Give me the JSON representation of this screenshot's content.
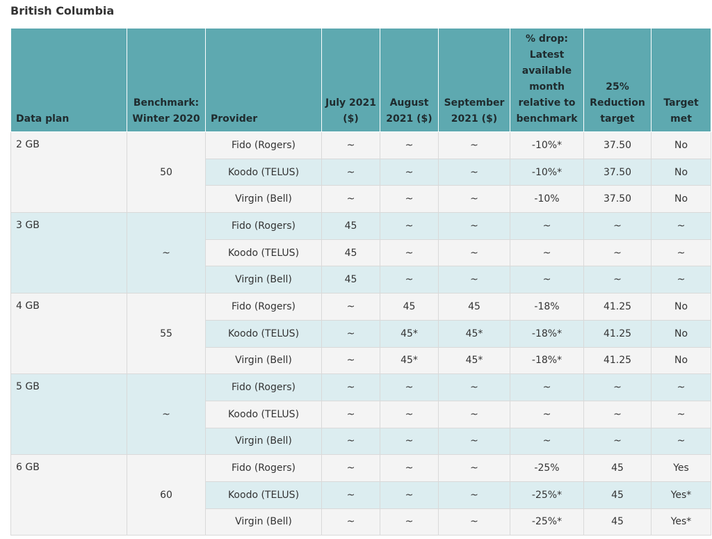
{
  "heading": "British Columbia",
  "columns": [
    "Data plan",
    "Benchmark: Winter 2020",
    "Provider",
    "July 2021 ($)",
    "August 2021 ($)",
    "September 2021 ($)",
    "% drop: Latest available month relative to benchmark",
    "25% Reduction target",
    "Target met"
  ],
  "groups": [
    {
      "plan": "2 GB",
      "benchmark": "50",
      "rows": [
        {
          "provider": "Fido (Rogers)",
          "july": "~",
          "august": "~",
          "september": "~",
          "drop": "-10%*",
          "target": "37.50",
          "met": "No"
        },
        {
          "provider": "Koodo (TELUS)",
          "july": "~",
          "august": "~",
          "september": "~",
          "drop": "-10%*",
          "target": "37.50",
          "met": "No"
        },
        {
          "provider": "Virgin (Bell)",
          "july": "~",
          "august": "~",
          "september": "~",
          "drop": "-10%",
          "target": "37.50",
          "met": "No"
        }
      ]
    },
    {
      "plan": "3 GB",
      "benchmark": "~",
      "rows": [
        {
          "provider": "Fido (Rogers)",
          "july": "45",
          "august": "~",
          "september": "~",
          "drop": "~",
          "target": "~",
          "met": "~"
        },
        {
          "provider": "Koodo (TELUS)",
          "july": "45",
          "august": "~",
          "september": "~",
          "drop": "~",
          "target": "~",
          "met": "~"
        },
        {
          "provider": "Virgin (Bell)",
          "july": "45",
          "august": "~",
          "september": "~",
          "drop": "~",
          "target": "~",
          "met": "~"
        }
      ]
    },
    {
      "plan": "4 GB",
      "benchmark": "55",
      "rows": [
        {
          "provider": "Fido (Rogers)",
          "july": "~",
          "august": "45",
          "september": "45",
          "drop": "-18%",
          "target": "41.25",
          "met": "No"
        },
        {
          "provider": "Koodo (TELUS)",
          "july": "~",
          "august": "45*",
          "september": "45*",
          "drop": "-18%*",
          "target": "41.25",
          "met": "No"
        },
        {
          "provider": "Virgin (Bell)",
          "july": "~",
          "august": "45*",
          "september": "45*",
          "drop": "-18%*",
          "target": "41.25",
          "met": "No"
        }
      ]
    },
    {
      "plan": "5 GB",
      "benchmark": "~",
      "rows": [
        {
          "provider": "Fido (Rogers)",
          "july": "~",
          "august": "~",
          "september": "~",
          "drop": "~",
          "target": "~",
          "met": "~"
        },
        {
          "provider": "Koodo (TELUS)",
          "july": "~",
          "august": "~",
          "september": "~",
          "drop": "~",
          "target": "~",
          "met": "~"
        },
        {
          "provider": "Virgin (Bell)",
          "july": "~",
          "august": "~",
          "september": "~",
          "drop": "~",
          "target": "~",
          "met": "~"
        }
      ]
    },
    {
      "plan": "6 GB",
      "benchmark": "60",
      "rows": [
        {
          "provider": "Fido (Rogers)",
          "july": "~",
          "august": "~",
          "september": "~",
          "drop": "-25%",
          "target": "45",
          "met": "Yes"
        },
        {
          "provider": "Koodo (TELUS)",
          "july": "~",
          "august": "~",
          "september": "~",
          "drop": "-25%*",
          "target": "45",
          "met": "Yes*"
        },
        {
          "provider": "Virgin (Bell)",
          "july": "~",
          "august": "~",
          "september": "~",
          "drop": "-25%*",
          "target": "45",
          "met": "Yes*"
        }
      ]
    }
  ]
}
